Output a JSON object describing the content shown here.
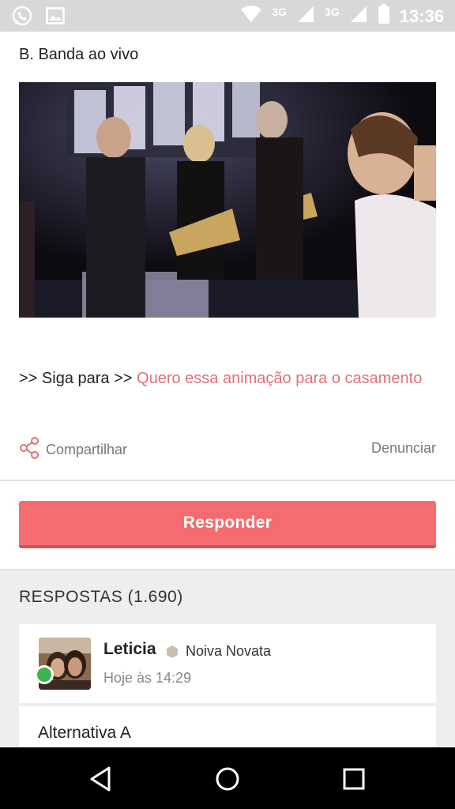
{
  "status_bar": {
    "network_1": "3G",
    "network_2": "3G",
    "time": "13:36"
  },
  "post": {
    "option_label": "B. Banda ao vivo",
    "cta_prefix": ">> Siga para >> ",
    "cta_link": "Quero essa animação para o casamento",
    "share_label": "Compartilhar",
    "report_label": "Denunciar"
  },
  "reply_button": {
    "label": "Responder"
  },
  "responses": {
    "title": "RESPOSTAS (1.690)",
    "items": [
      {
        "user": "Leticia",
        "rank": "Noiva Novata",
        "time": "Hoje às 14:29",
        "text": "Alternativa A"
      }
    ]
  },
  "colors": {
    "accent": "#f36d70",
    "link": "#e0707a",
    "online": "#3cb44b",
    "status_bar": "#d8d8d8",
    "nav_bar": "#000000"
  },
  "icons": {
    "status_left": [
      "whatsapp-icon",
      "gallery-icon"
    ],
    "status_right": [
      "wifi-icon",
      "signal-icon",
      "signal-icon",
      "battery-icon"
    ],
    "share": "share-icon",
    "badge": "hexagon-badge-icon",
    "nav": [
      "back-icon",
      "home-icon",
      "recents-icon"
    ]
  }
}
